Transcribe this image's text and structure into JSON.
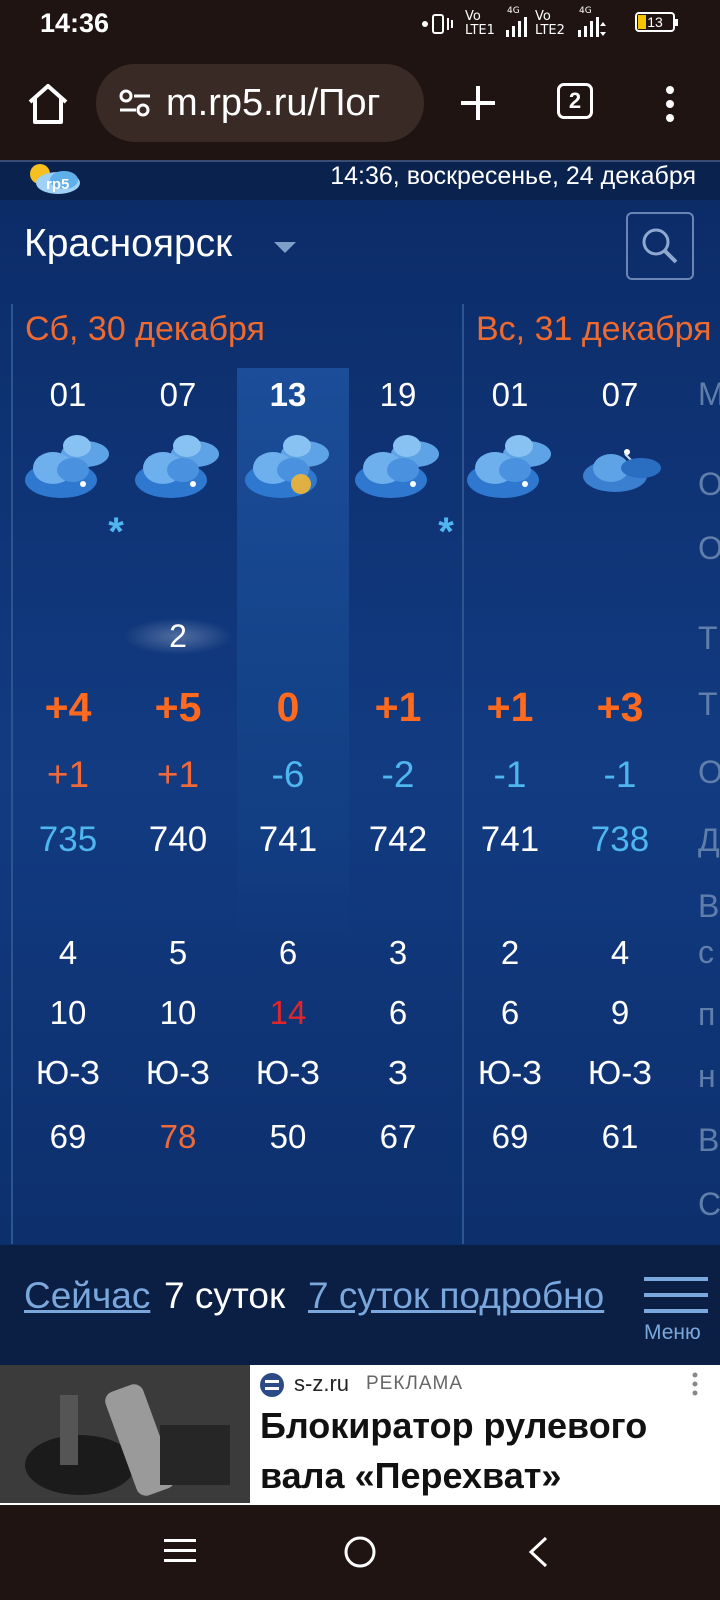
{
  "status_bar": {
    "time": "14:36",
    "sim1_top": "Vo",
    "sim1_bottom": "LTE1",
    "sim1_net": "4G",
    "sim2_top": "Vo",
    "sim2_bottom": "LTE2",
    "sim2_net": "4G",
    "battery": "13"
  },
  "browser": {
    "url": "m.rp5.ru/Пог",
    "tab_count": "2"
  },
  "site": {
    "logo_text": "rp5",
    "datetime": "14:36, воскресенье, 24 декабря",
    "city": "Красноярск"
  },
  "days": [
    "Сб, 30 декабря",
    "Вс, 31 декабря"
  ],
  "forecast": [
    {
      "hour": "01",
      "icon": "cloudy-night-icon",
      "snow": "*",
      "cloud": "",
      "temp": "+4",
      "feels": "+1",
      "pressure": "735",
      "wind": "4",
      "gust": "10",
      "dir": "Ю-З",
      "humidity": "69"
    },
    {
      "hour": "07",
      "icon": "cloudy-night-icon",
      "snow": "",
      "cloud": "2",
      "temp": "+5",
      "feels": "+1",
      "pressure": "740",
      "wind": "5",
      "gust": "10",
      "dir": "Ю-З",
      "humidity": "78"
    },
    {
      "hour": "13",
      "icon": "cloudy-sun-icon",
      "snow": "",
      "cloud": "",
      "temp": "0",
      "feels": "-6",
      "pressure": "741",
      "wind": "6",
      "gust": "14",
      "dir": "Ю-З",
      "humidity": "50"
    },
    {
      "hour": "19",
      "icon": "cloudy-night-icon",
      "snow": "*",
      "cloud": "",
      "temp": "+1",
      "feels": "-2",
      "pressure": "742",
      "wind": "3",
      "gust": "6",
      "dir": "З",
      "humidity": "67"
    },
    {
      "hour": "01",
      "icon": "cloudy-night-icon",
      "snow": "",
      "cloud": "",
      "temp": "+1",
      "feels": "-1",
      "pressure": "741",
      "wind": "2",
      "gust": "6",
      "dir": "Ю-З",
      "humidity": "69"
    },
    {
      "hour": "07",
      "icon": "partly-cloudy-night-icon",
      "snow": "",
      "cloud": "",
      "temp": "+3",
      "feels": "-1",
      "pressure": "738",
      "wind": "4",
      "gust": "9",
      "dir": "Ю-З",
      "humidity": "61"
    }
  ],
  "side_labels": [
    "М",
    "О",
    "О",
    "Т",
    "Т",
    "О",
    "Д",
    "В",
    "с",
    "п",
    "н",
    "В",
    "С"
  ],
  "colors": {
    "orange": "#ff6a1f",
    "light_orange": "#ee6a3a",
    "cyan": "#4fb6f0",
    "red": "#e0262a",
    "white": "#ffffff"
  },
  "bottom_nav": {
    "now": "Сейчас",
    "seven_days": "7 суток",
    "seven_days_detail": "7 суток подробно",
    "menu": "Меню"
  },
  "ad": {
    "domain": "s-z.ru",
    "label": "РЕКЛАМА",
    "title": "Блокиратор рулевого вала «Перехват»"
  }
}
